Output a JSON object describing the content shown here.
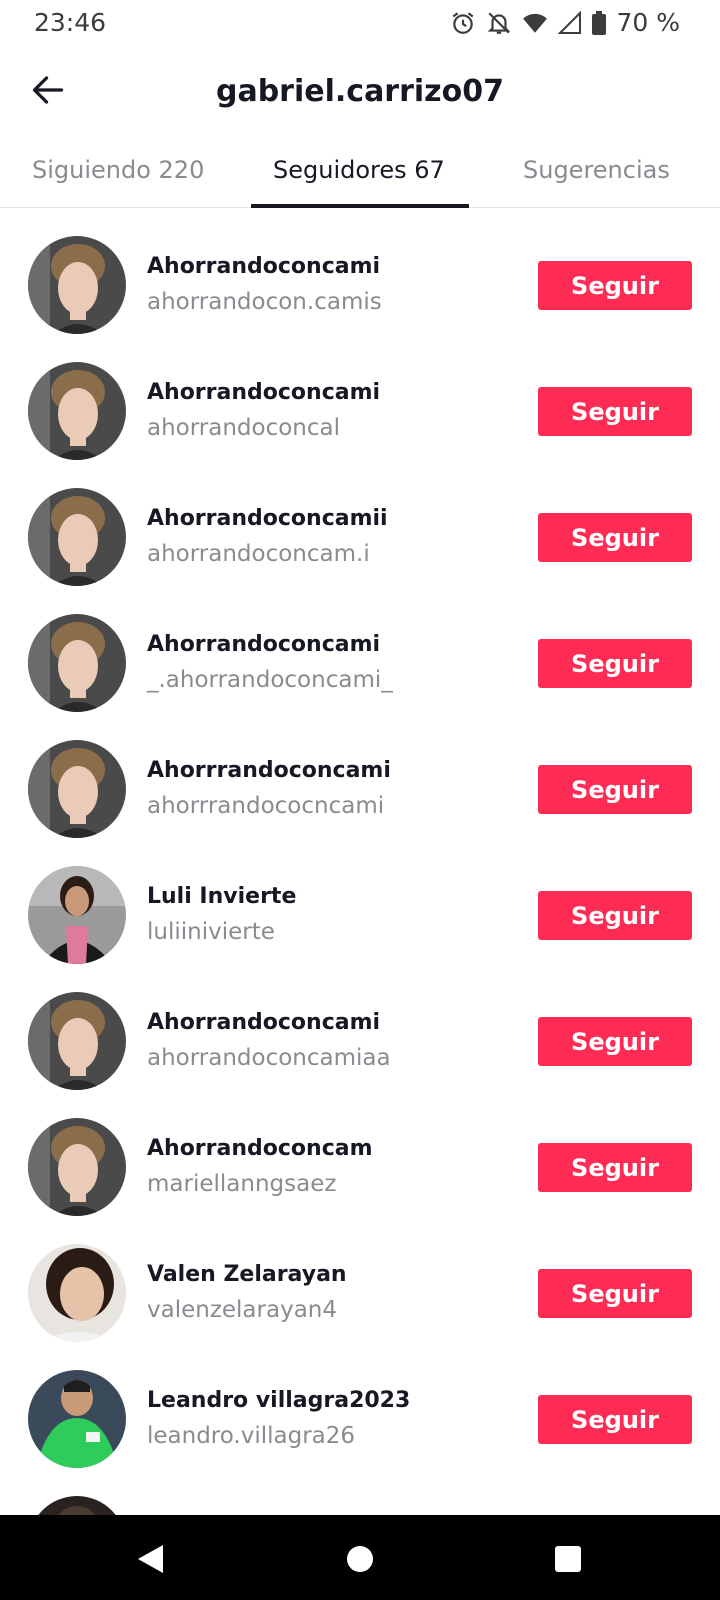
{
  "status_bar": {
    "time": "23:46",
    "battery": "70 %",
    "icons": [
      "alarm-icon",
      "bell-off-icon",
      "wifi-icon",
      "signal-icon",
      "battery-icon"
    ]
  },
  "header": {
    "title": "gabriel.carrizo07",
    "back_icon": "arrow-left-icon"
  },
  "tabs": [
    {
      "label": "Siguiendo 220",
      "active": false
    },
    {
      "label": "Seguidores 67",
      "active": true
    },
    {
      "label": "Sugerencias",
      "active": false
    }
  ],
  "follow_label": "Seguir",
  "colors": {
    "accent": "#fe2c55",
    "text_primary": "#161823",
    "text_secondary": "#8a8b91"
  },
  "followers": [
    {
      "name": "Ahorrandoconcami",
      "username": "ahorrandocon.camis",
      "button": "Seguir"
    },
    {
      "name": "Ahorrandoconcami",
      "username": "ahorrandoconcal",
      "button": "Seguir"
    },
    {
      "name": "Ahorrandoconcamii",
      "username": "ahorrandoconcam.i",
      "button": "Seguir"
    },
    {
      "name": "Ahorrandoconcami",
      "username": "_.ahorrandoconcami_",
      "button": "Seguir"
    },
    {
      "name": "Ahorrrandoconcami",
      "username": "ahorrrandococncami",
      "button": "Seguir"
    },
    {
      "name": "Luli Invierte",
      "username": "luliinivierte",
      "button": "Seguir"
    },
    {
      "name": "Ahorrandoconcami",
      "username": "ahorrandoconcamiaa",
      "button": "Seguir"
    },
    {
      "name": "Ahorrandoconcam",
      "username": "mariellanngsaez",
      "button": "Seguir"
    },
    {
      "name": "Valen Zelarayan",
      "username": "valenzelarayan4",
      "button": "Seguir"
    },
    {
      "name": "Leandro villagra2023",
      "username": "leandro.villagra26",
      "button": "Seguir"
    }
  ],
  "nav_bar": {
    "icons": [
      "back-triangle-icon",
      "home-circle-icon",
      "recents-square-icon"
    ]
  }
}
